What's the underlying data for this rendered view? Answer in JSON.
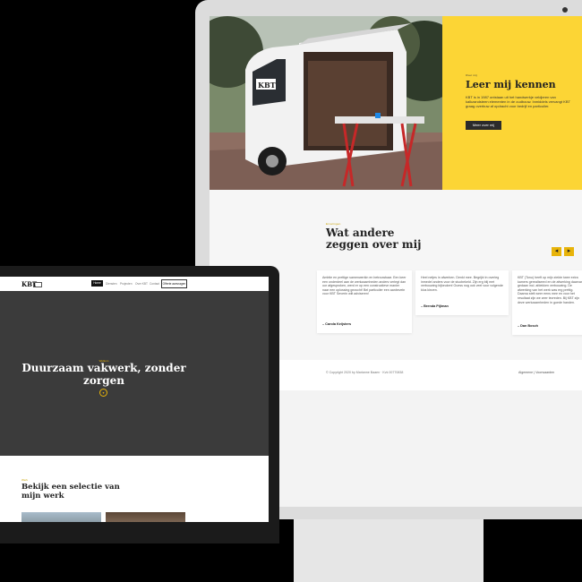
{
  "back_site": {
    "hero": {
      "eyebrow": "Over mij",
      "title": "Leer mij kennen",
      "text": "KBT is in 1987 ontstaan uit het handwerkje veldjeren van kalkzandsteen elementen in de oudbouw. Inmiddels vervangt KBT graag overbuw af opdracht voor bedrijf en particulier.",
      "button_label": "Meer over mij",
      "van_logo": "KBT"
    },
    "testimonials": {
      "eyebrow": "Ervaringen",
      "title": "Wat andere zeggen over mij",
      "prev_icon": "chevron-left-icon",
      "next_icon": "chevron-right-icon",
      "cards": [
        {
          "text": "Ambtie en prettige samenwerkin en betrouwbaar. Een keer een onderdeel aan de werkzaamheden anders verlegt dan oor afgesproken, werd er op een constructieve manier naar een oplossing gezocht! Bel particulier een aanbeveln voor KBT Severin wilt adviseren!",
          "author": "– Carola Keijsters"
        },
        {
          "text": "Heel netjes in afwerken. Denkt mee. Begrijkt in overleg inmedel anders voor de stucbekeld. Zijn erg blij met verbouwing bijkeuken! Ouess nog ook veel voor volgende klus kiezen.",
          "author": "– Brenda Pijlman"
        },
        {
          "text": "KBT (Tonu) heeft op mijn ziekte twee extra kamers gerealiseerd en de afwerking daarvan gedaan incl. afdekken verbouwing. De afwerking van het werk was erg prettig. Daarna stelt weer eens mee en voor het resultaat zijn we zeer tevreden. Bij KBT zijn deze werkzaamheden in goede handen.",
          "author": "– Dan Bosch"
        }
      ]
    },
    "footer": {
      "copyright": "© Copyright 2020 by Marianne Baaen · Kvk 00770838",
      "privacy": "Algemene | Voorwaarden"
    }
  },
  "front_site": {
    "logo": "KBT",
    "nav": {
      "home": "Home",
      "items": [
        "Diensten",
        "Projecten",
        "Over KBT",
        "Contact"
      ],
      "cta": "Offerte aanvragen"
    },
    "hero": {
      "eyebrow": "Welkom",
      "title": "Duurzaam vakwerk, zonder zorgen",
      "scroll_icon": "chevron-down-icon"
    },
    "work": {
      "eyebrow": "Werk",
      "title": "Bekijk een selectie van mijn werk"
    }
  },
  "colors": {
    "accent": "#fcd535",
    "accent_dark": "#e8b40a",
    "dark": "#3b3b3b"
  }
}
